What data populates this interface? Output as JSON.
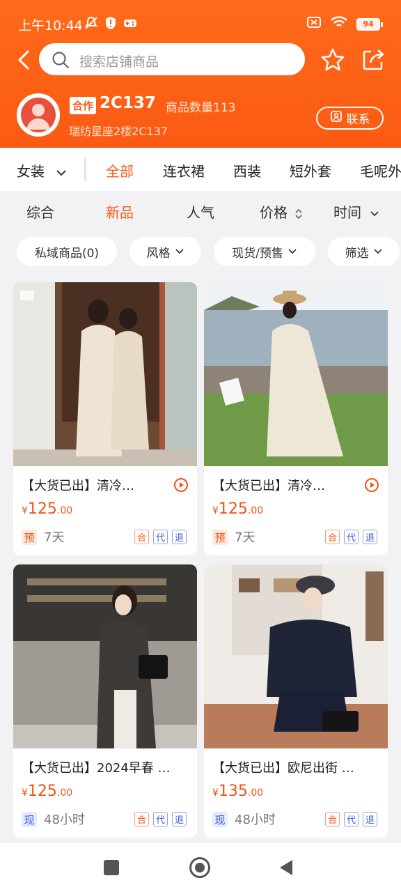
{
  "status_bar": {
    "time": "上午10:44",
    "battery": "94"
  },
  "search": {
    "placeholder": "搜索店铺商品"
  },
  "shop": {
    "badge": "合作",
    "name": "2C137",
    "count_label": "商品数量113",
    "address": "瑞纺星座2楼2C137",
    "contact_label": "联系"
  },
  "categories": {
    "current": "女装",
    "items": [
      "全部",
      "连衣裙",
      "西装",
      "短外套",
      "毛呢外套"
    ],
    "active_index": 0
  },
  "sort": {
    "items": [
      "综合",
      "新品",
      "人气",
      "价格",
      "时间"
    ],
    "active_index": 1
  },
  "filters": [
    "私域商品(0)",
    "风格",
    "现货/预售",
    "筛选"
  ],
  "products": [
    {
      "title": "【大货已出】清冷…",
      "price_int": "125",
      "price_dec": ".00",
      "currency": "¥",
      "stock": "预",
      "lead_time": "7天",
      "tags": [
        "合",
        "代",
        "退"
      ],
      "has_video": true
    },
    {
      "title": "【大货已出】清冷…",
      "price_int": "125",
      "price_dec": ".00",
      "currency": "¥",
      "stock": "预",
      "lead_time": "7天",
      "tags": [
        "合",
        "代",
        "退"
      ],
      "has_video": true
    },
    {
      "title": "【大货已出】2024早春 …",
      "price_int": "125",
      "price_dec": ".00",
      "currency": "¥",
      "stock": "现",
      "lead_time": "48小时",
      "tags": [
        "合",
        "代",
        "退"
      ],
      "has_video": false
    },
    {
      "title": "【大货已出】欧尼出街 …",
      "price_int": "135",
      "price_dec": ".00",
      "currency": "¥",
      "stock": "现",
      "lead_time": "48小时",
      "tags": [
        "合",
        "代",
        "退"
      ],
      "has_video": false
    }
  ],
  "colors": {
    "brand": "#fb5a12",
    "price": "#f25314",
    "blue_tag": "#3b5bdb"
  }
}
